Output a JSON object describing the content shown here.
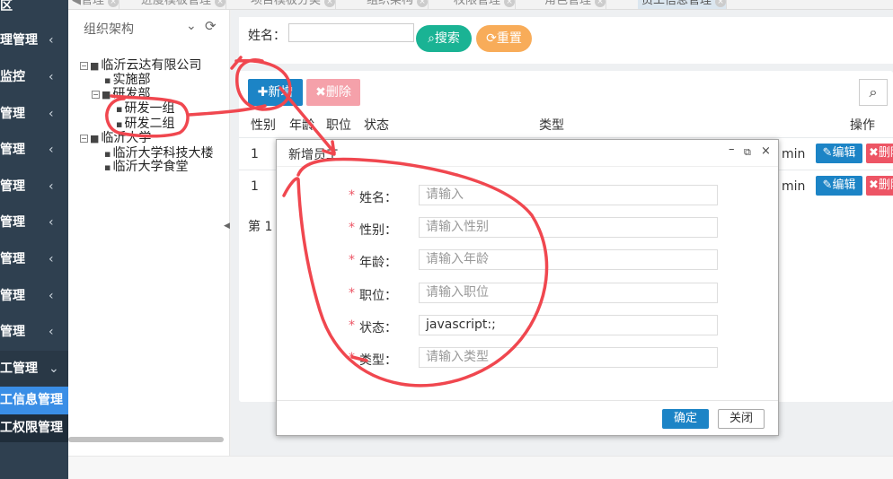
{
  "sidebar": {
    "items": [
      {
        "label": "区",
        "chevron": ""
      },
      {
        "label": "理管理",
        "chevron": "‹"
      },
      {
        "label": "监控",
        "chevron": "‹"
      },
      {
        "label": "管理",
        "chevron": "‹"
      },
      {
        "label": "管理",
        "chevron": "‹"
      },
      {
        "label": "管理",
        "chevron": "‹"
      },
      {
        "label": "管理",
        "chevron": "‹"
      },
      {
        "label": "管理",
        "chevron": "‹"
      },
      {
        "label": "管理",
        "chevron": "‹"
      },
      {
        "label": "管理",
        "chevron": "‹"
      },
      {
        "label": "工管理",
        "chevron": "⌄"
      }
    ],
    "subitems": [
      {
        "label": "工信息管理"
      },
      {
        "label": "工权限管理"
      }
    ]
  },
  "tabs": [
    {
      "label": "◀管理"
    },
    {
      "label": "进度模板管理"
    },
    {
      "label": "项目模板分类"
    },
    {
      "label": "组织架构"
    },
    {
      "label": "权限管理"
    },
    {
      "label": "角色管理"
    },
    {
      "label": "员工信息管理"
    }
  ],
  "tree": {
    "title": "组织架构",
    "nodes": [
      {
        "label": "临沂云达有限公司",
        "toggle": "−"
      },
      {
        "label": "实施部",
        "toggle": ""
      },
      {
        "label": "研发部",
        "toggle": "−"
      },
      {
        "label": "研发一组",
        "toggle": ""
      },
      {
        "label": "研发二组",
        "toggle": ""
      },
      {
        "label": "临沂大学",
        "toggle": "−"
      },
      {
        "label": "临沂大学科技大楼",
        "toggle": ""
      },
      {
        "label": "临沂大学食堂",
        "toggle": ""
      }
    ]
  },
  "search": {
    "name_label": "姓名：",
    "name_value": "",
    "search_label": "搜索",
    "reset_label": "重置"
  },
  "toolbar": {
    "add_label": "新增",
    "delete_label": "删除"
  },
  "table": {
    "headers": [
      "性别",
      "年龄",
      "职位",
      "状态",
      "类型",
      "操作"
    ],
    "rows": [
      {
        "index": "1",
        "tail": "min",
        "edit": "编辑",
        "delete": "删除"
      },
      {
        "index": "1",
        "tail": "min",
        "edit": "编辑",
        "delete": "删除"
      }
    ],
    "pager": "第 1"
  },
  "modal": {
    "title": "新增员工",
    "fields": [
      {
        "required": "*",
        "label": "姓名：",
        "value": "",
        "placeholder": "请输入"
      },
      {
        "required": "*",
        "label": "性别：",
        "value": "",
        "placeholder": "请输入性别"
      },
      {
        "required": "*",
        "label": "年龄：",
        "value": "",
        "placeholder": "请输入年龄"
      },
      {
        "required": "*",
        "label": "职位：",
        "value": "",
        "placeholder": "请输入职位"
      },
      {
        "required": "*",
        "label": "状态：",
        "value": "javascript:;",
        "placeholder": ""
      },
      {
        "required": "*",
        "label": "类型：",
        "value": "",
        "placeholder": "请输入类型"
      }
    ],
    "ok_label": "确定",
    "close_label": "关闭"
  },
  "colors": {
    "sidebar_bg": "#2f4050",
    "primary": "#1c84c6",
    "success": "#1ab394",
    "warning": "#f8ac59",
    "danger": "#ed5565",
    "annotation": "#f0474f"
  }
}
